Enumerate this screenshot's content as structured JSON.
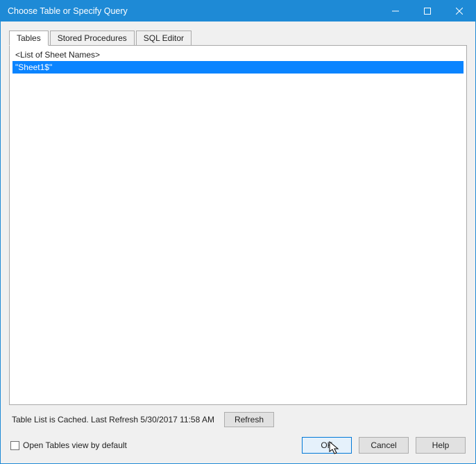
{
  "titlebar": {
    "title": "Choose Table or Specify Query"
  },
  "tabs": {
    "tables": "Tables",
    "stored_procedures": "Stored Procedures",
    "sql_editor": "SQL Editor"
  },
  "listbox": {
    "header": "<List of Sheet Names>",
    "items": [
      "\"Sheet1$\""
    ]
  },
  "status": {
    "text": "Table List is Cached.  Last Refresh 5/30/2017 11:58 AM",
    "refresh_label": "Refresh"
  },
  "footer": {
    "checkbox_label": "Open Tables view by default",
    "ok": "OK",
    "cancel": "Cancel",
    "help": "Help"
  }
}
